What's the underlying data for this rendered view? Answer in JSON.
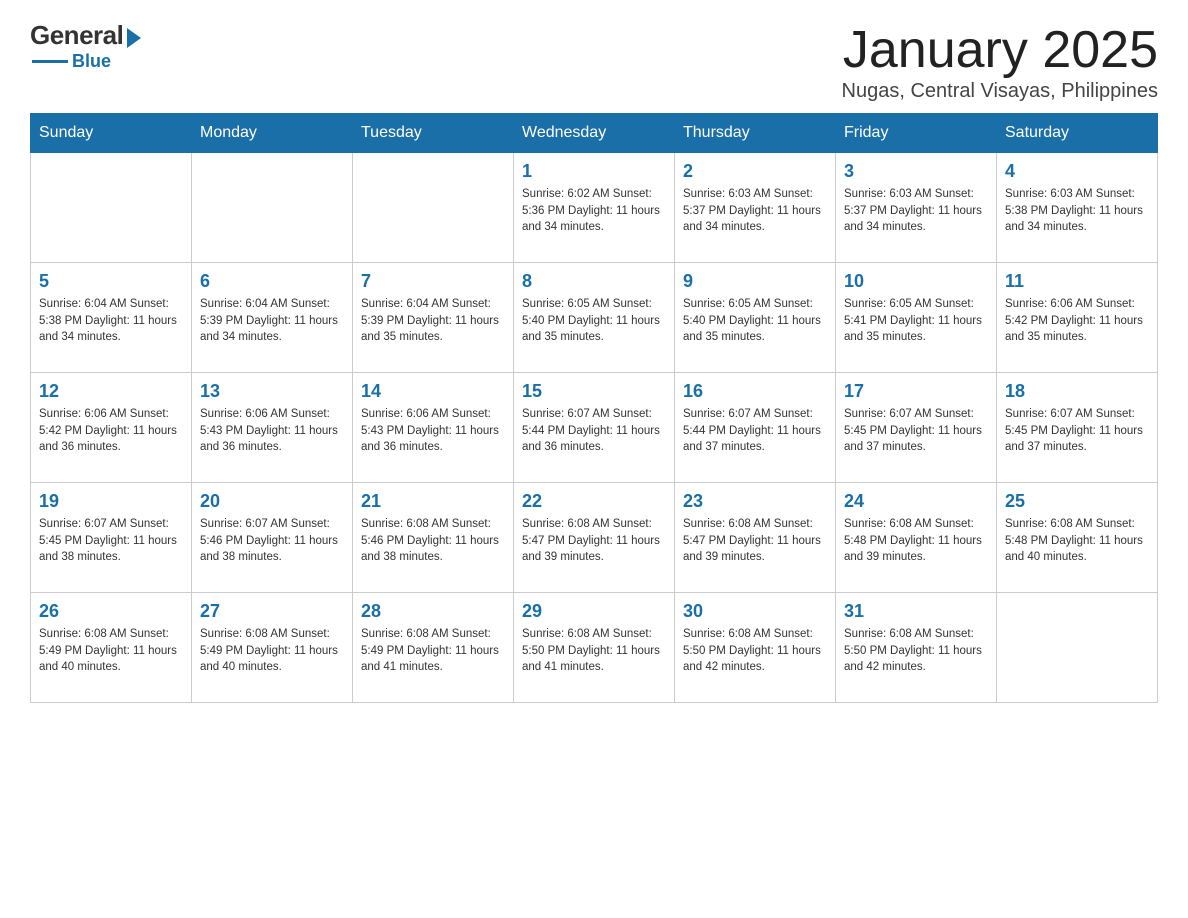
{
  "header": {
    "logo": {
      "general": "General",
      "blue": "Blue"
    },
    "title": "January 2025",
    "location": "Nugas, Central Visayas, Philippines"
  },
  "calendar": {
    "days_of_week": [
      "Sunday",
      "Monday",
      "Tuesday",
      "Wednesday",
      "Thursday",
      "Friday",
      "Saturday"
    ],
    "weeks": [
      [
        {
          "day": "",
          "info": ""
        },
        {
          "day": "",
          "info": ""
        },
        {
          "day": "",
          "info": ""
        },
        {
          "day": "1",
          "info": "Sunrise: 6:02 AM\nSunset: 5:36 PM\nDaylight: 11 hours\nand 34 minutes."
        },
        {
          "day": "2",
          "info": "Sunrise: 6:03 AM\nSunset: 5:37 PM\nDaylight: 11 hours\nand 34 minutes."
        },
        {
          "day": "3",
          "info": "Sunrise: 6:03 AM\nSunset: 5:37 PM\nDaylight: 11 hours\nand 34 minutes."
        },
        {
          "day": "4",
          "info": "Sunrise: 6:03 AM\nSunset: 5:38 PM\nDaylight: 11 hours\nand 34 minutes."
        }
      ],
      [
        {
          "day": "5",
          "info": "Sunrise: 6:04 AM\nSunset: 5:38 PM\nDaylight: 11 hours\nand 34 minutes."
        },
        {
          "day": "6",
          "info": "Sunrise: 6:04 AM\nSunset: 5:39 PM\nDaylight: 11 hours\nand 34 minutes."
        },
        {
          "day": "7",
          "info": "Sunrise: 6:04 AM\nSunset: 5:39 PM\nDaylight: 11 hours\nand 35 minutes."
        },
        {
          "day": "8",
          "info": "Sunrise: 6:05 AM\nSunset: 5:40 PM\nDaylight: 11 hours\nand 35 minutes."
        },
        {
          "day": "9",
          "info": "Sunrise: 6:05 AM\nSunset: 5:40 PM\nDaylight: 11 hours\nand 35 minutes."
        },
        {
          "day": "10",
          "info": "Sunrise: 6:05 AM\nSunset: 5:41 PM\nDaylight: 11 hours\nand 35 minutes."
        },
        {
          "day": "11",
          "info": "Sunrise: 6:06 AM\nSunset: 5:42 PM\nDaylight: 11 hours\nand 35 minutes."
        }
      ],
      [
        {
          "day": "12",
          "info": "Sunrise: 6:06 AM\nSunset: 5:42 PM\nDaylight: 11 hours\nand 36 minutes."
        },
        {
          "day": "13",
          "info": "Sunrise: 6:06 AM\nSunset: 5:43 PM\nDaylight: 11 hours\nand 36 minutes."
        },
        {
          "day": "14",
          "info": "Sunrise: 6:06 AM\nSunset: 5:43 PM\nDaylight: 11 hours\nand 36 minutes."
        },
        {
          "day": "15",
          "info": "Sunrise: 6:07 AM\nSunset: 5:44 PM\nDaylight: 11 hours\nand 36 minutes."
        },
        {
          "day": "16",
          "info": "Sunrise: 6:07 AM\nSunset: 5:44 PM\nDaylight: 11 hours\nand 37 minutes."
        },
        {
          "day": "17",
          "info": "Sunrise: 6:07 AM\nSunset: 5:45 PM\nDaylight: 11 hours\nand 37 minutes."
        },
        {
          "day": "18",
          "info": "Sunrise: 6:07 AM\nSunset: 5:45 PM\nDaylight: 11 hours\nand 37 minutes."
        }
      ],
      [
        {
          "day": "19",
          "info": "Sunrise: 6:07 AM\nSunset: 5:45 PM\nDaylight: 11 hours\nand 38 minutes."
        },
        {
          "day": "20",
          "info": "Sunrise: 6:07 AM\nSunset: 5:46 PM\nDaylight: 11 hours\nand 38 minutes."
        },
        {
          "day": "21",
          "info": "Sunrise: 6:08 AM\nSunset: 5:46 PM\nDaylight: 11 hours\nand 38 minutes."
        },
        {
          "day": "22",
          "info": "Sunrise: 6:08 AM\nSunset: 5:47 PM\nDaylight: 11 hours\nand 39 minutes."
        },
        {
          "day": "23",
          "info": "Sunrise: 6:08 AM\nSunset: 5:47 PM\nDaylight: 11 hours\nand 39 minutes."
        },
        {
          "day": "24",
          "info": "Sunrise: 6:08 AM\nSunset: 5:48 PM\nDaylight: 11 hours\nand 39 minutes."
        },
        {
          "day": "25",
          "info": "Sunrise: 6:08 AM\nSunset: 5:48 PM\nDaylight: 11 hours\nand 40 minutes."
        }
      ],
      [
        {
          "day": "26",
          "info": "Sunrise: 6:08 AM\nSunset: 5:49 PM\nDaylight: 11 hours\nand 40 minutes."
        },
        {
          "day": "27",
          "info": "Sunrise: 6:08 AM\nSunset: 5:49 PM\nDaylight: 11 hours\nand 40 minutes."
        },
        {
          "day": "28",
          "info": "Sunrise: 6:08 AM\nSunset: 5:49 PM\nDaylight: 11 hours\nand 41 minutes."
        },
        {
          "day": "29",
          "info": "Sunrise: 6:08 AM\nSunset: 5:50 PM\nDaylight: 11 hours\nand 41 minutes."
        },
        {
          "day": "30",
          "info": "Sunrise: 6:08 AM\nSunset: 5:50 PM\nDaylight: 11 hours\nand 42 minutes."
        },
        {
          "day": "31",
          "info": "Sunrise: 6:08 AM\nSunset: 5:50 PM\nDaylight: 11 hours\nand 42 minutes."
        },
        {
          "day": "",
          "info": ""
        }
      ]
    ]
  }
}
